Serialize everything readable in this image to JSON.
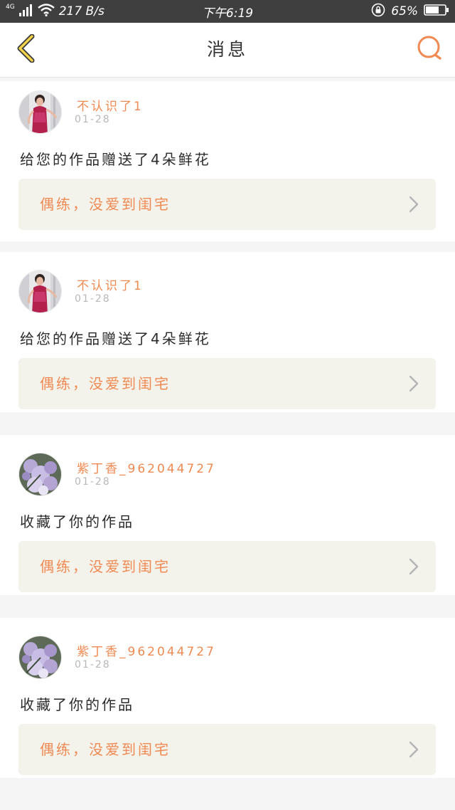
{
  "status_bar": {
    "network": "4G",
    "speed": "217 B/s",
    "time": "下午6:19",
    "battery": "65%"
  },
  "header": {
    "title": "消息"
  },
  "notifications": [
    {
      "username": "不认识了1",
      "date": "01-28",
      "message": "给您的作品赠送了4朵鲜花",
      "work_title": "偶练，没爱到闺宅",
      "avatar": "qipao-woman-avatar"
    },
    {
      "username": "不认识了1",
      "date": "01-28",
      "message": "给您的作品赠送了4朵鲜花",
      "work_title": "偶练，没爱到闺宅",
      "avatar": "qipao-woman-avatar"
    },
    {
      "username": "紫丁香_962044727",
      "date": "01-28",
      "message": "收藏了你的作品",
      "work_title": "偶练，没爱到闺宅",
      "avatar": "lilac-flower-avatar"
    },
    {
      "username": "紫丁香_962044727",
      "date": "01-28",
      "message": "收藏了你的作品",
      "work_title": "偶练，没爱到闺宅",
      "avatar": "lilac-flower-avatar"
    }
  ],
  "colors": {
    "accent": "#f08a52",
    "back_arrow": "#f2d34a",
    "status_bar_bg": "#3f3f3f",
    "card_link_bg": "#f3f3ec"
  }
}
